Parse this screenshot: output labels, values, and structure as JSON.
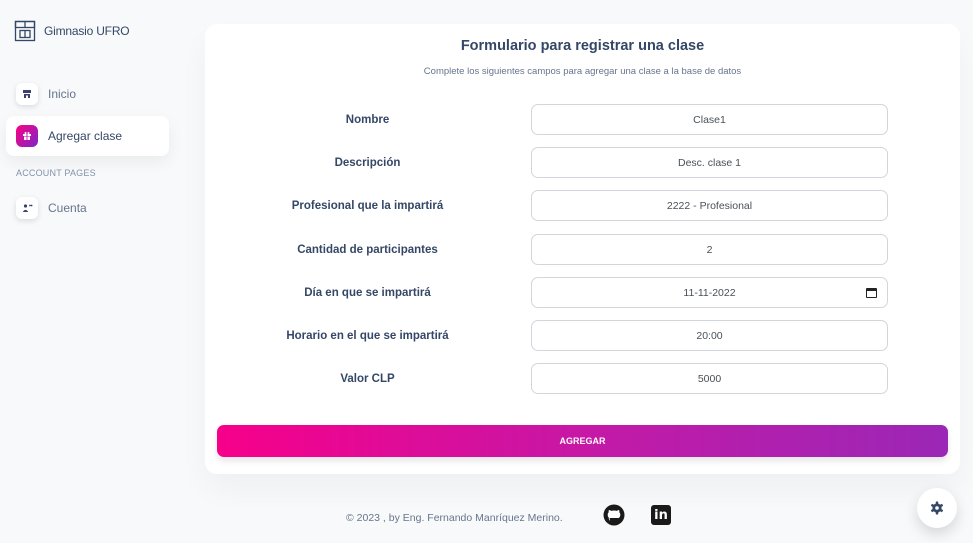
{
  "brand": {
    "name": "Gimnasio UFRO",
    "icon": "building-icon"
  },
  "sidebar": {
    "items": [
      {
        "label": "Inicio",
        "icon": "store-icon"
      },
      {
        "label": "Agregar clase",
        "icon": "gift-box-icon",
        "active": true
      }
    ],
    "section_label": "ACCOUNT PAGES",
    "account_items": [
      {
        "label": "Cuenta",
        "icon": "user-icon"
      }
    ]
  },
  "form": {
    "title": "Formulario para registrar una clase",
    "subtitle": "Complete los siguientes campos para agregar una clase a la base de datos",
    "fields": [
      {
        "label": "Nombre",
        "value": "Clase1"
      },
      {
        "label": "Descripción",
        "value": "Desc. clase 1"
      },
      {
        "label": "Profesional que la impartirá",
        "value": "2222 - Profesional"
      },
      {
        "label": "Cantidad de participantes",
        "value": "2"
      },
      {
        "label": "Día en que se impartirá",
        "value": "11-11-2022"
      },
      {
        "label": "Horario en el que se impartirá",
        "value": "20:00"
      },
      {
        "label": "Valor CLP",
        "value": "5000"
      }
    ],
    "submit_label": "AGREGAR"
  },
  "footer": {
    "text": "© 2023 , by Eng. Fernando Manríquez Merino.",
    "icons": [
      "github-icon",
      "linkedin-icon"
    ]
  },
  "colors": {
    "accent_start": "#f7008a",
    "accent_end": "#9b27b6",
    "text": "#344767"
  }
}
